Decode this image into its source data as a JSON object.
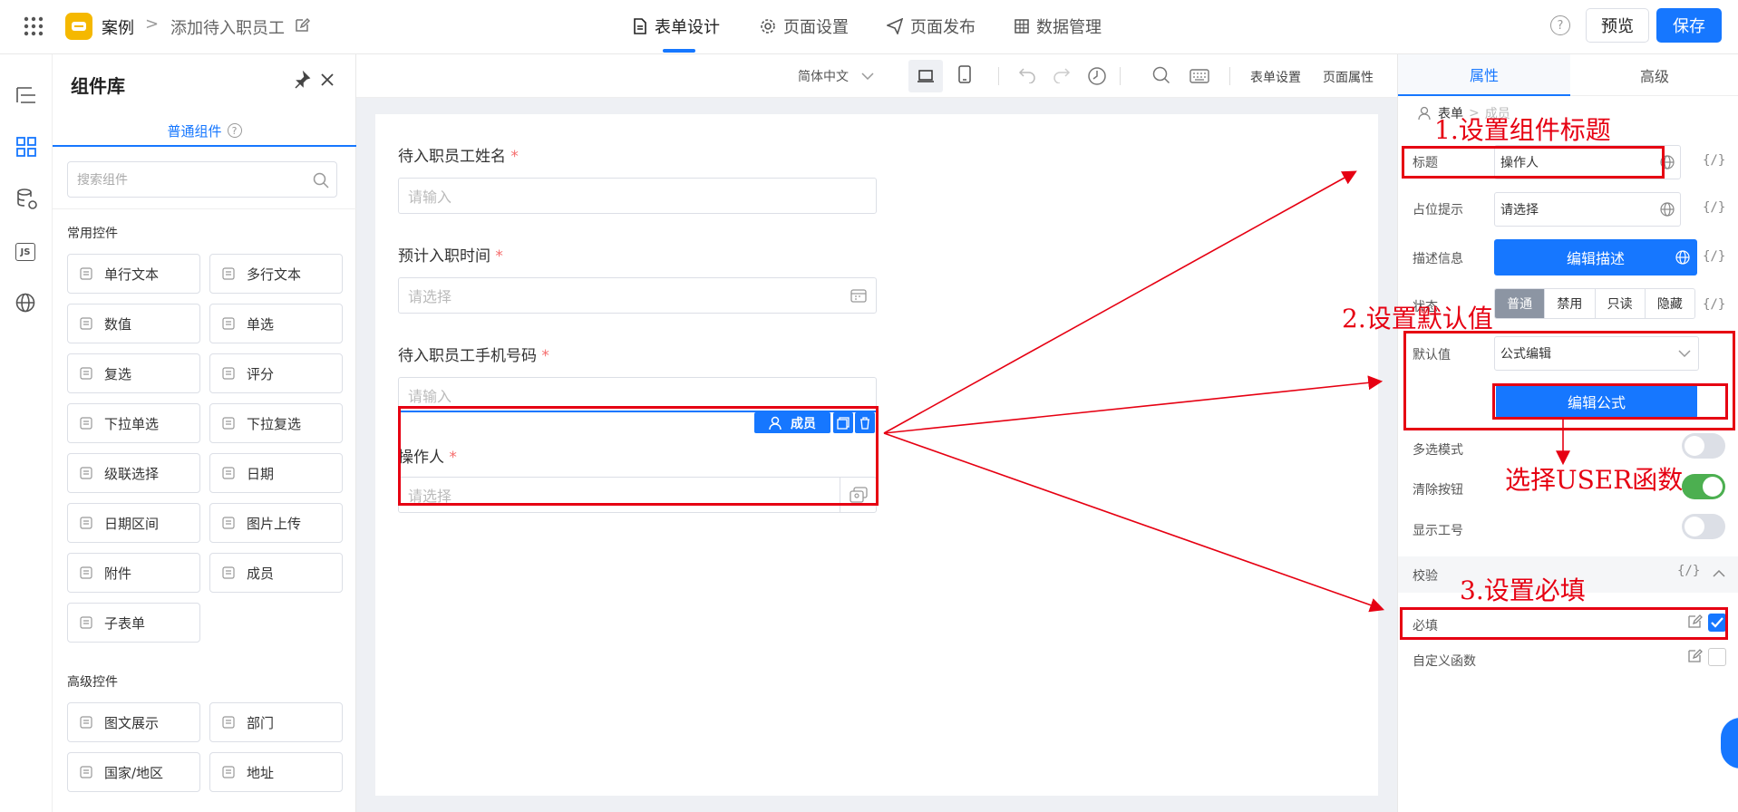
{
  "header": {
    "app_name": "案例",
    "breadcrumb_sep": ">",
    "page_name": "添加待入职员工",
    "tabs": [
      {
        "label": "表单设计",
        "active": true
      },
      {
        "label": "页面设置",
        "active": false
      },
      {
        "label": "页面发布",
        "active": false
      },
      {
        "label": "数据管理",
        "active": false
      }
    ],
    "help_icon_text": "?",
    "preview_label": "预览",
    "save_label": "保存"
  },
  "left_rail": {
    "js_badge": "JS"
  },
  "component_library": {
    "title": "组件库",
    "tab_label": "普通组件",
    "search_placeholder": "搜索组件",
    "common_section": "常用控件",
    "common_items": [
      {
        "label": "单行文本",
        "icon": "single-line-text-icon"
      },
      {
        "label": "多行文本",
        "icon": "multi-line-text-icon"
      },
      {
        "label": "数值",
        "icon": "number-icon"
      },
      {
        "label": "单选",
        "icon": "radio-icon"
      },
      {
        "label": "复选",
        "icon": "checkbox-icon"
      },
      {
        "label": "评分",
        "icon": "star-icon"
      },
      {
        "label": "下拉单选",
        "icon": "dropdown-single-icon"
      },
      {
        "label": "下拉复选",
        "icon": "dropdown-multi-icon"
      },
      {
        "label": "级联选择",
        "icon": "cascade-icon"
      },
      {
        "label": "日期",
        "icon": "calendar-icon"
      },
      {
        "label": "日期区间",
        "icon": "date-range-icon"
      },
      {
        "label": "图片上传",
        "icon": "image-upload-icon"
      },
      {
        "label": "附件",
        "icon": "paperclip-icon"
      },
      {
        "label": "成员",
        "icon": "member-icon"
      },
      {
        "label": "子表单",
        "icon": "subform-icon"
      }
    ],
    "advanced_section": "高级控件",
    "advanced_items": [
      {
        "label": "图文展示",
        "icon": "rich-text-icon"
      },
      {
        "label": "部门",
        "icon": "department-icon"
      },
      {
        "label": "国家/地区",
        "icon": "globe-icon"
      },
      {
        "label": "地址",
        "icon": "map-icon"
      }
    ]
  },
  "toolbar": {
    "language": "简体中文",
    "form_settings": "表单设置",
    "page_props": "页面属性"
  },
  "form": {
    "fields": [
      {
        "label": "待入职员工姓名",
        "required_mark": "*",
        "placeholder": "请输入"
      },
      {
        "label": "预计入职时间",
        "required_mark": "*",
        "placeholder": "请选择"
      },
      {
        "label": "待入职员工手机号码",
        "required_mark": "*",
        "placeholder": "请输入"
      },
      {
        "label": "操作人",
        "required_mark": "*",
        "placeholder": "请选择"
      }
    ],
    "selected_badge": "成员"
  },
  "props_panel": {
    "tabs": [
      "属性",
      "高级"
    ],
    "path": [
      "表单",
      "成员"
    ],
    "title_label": "标题",
    "title_value": "操作人",
    "placeholder_label": "占位提示",
    "placeholder_value": "请选择",
    "desc_label": "描述信息",
    "desc_button": "编辑描述",
    "status_label": "状态",
    "status_options": [
      "普通",
      "禁用",
      "只读",
      "隐藏"
    ],
    "default_label": "默认值",
    "default_value": "公式编辑",
    "edit_formula": "编辑公式",
    "multi_label": "多选模式",
    "multi_on": false,
    "clear_label": "清除按钮",
    "clear_on": true,
    "show_id_label": "显示工号",
    "show_id_on": false,
    "validation_label": "校验",
    "required_label": "必填",
    "required_checked": true,
    "custom_fn_label": "自定义函数",
    "custom_fn_checked": false,
    "code_glyph": "{/}"
  },
  "annotations": {
    "a1": "1.设置组件标题",
    "a2": "2.设置默认值",
    "a3": "选择USER函数",
    "a4": "3.设置必填"
  },
  "colors": {
    "primary": "#1677ff",
    "annotation_red": "#e60012",
    "toggle_on": "#4caf50"
  }
}
